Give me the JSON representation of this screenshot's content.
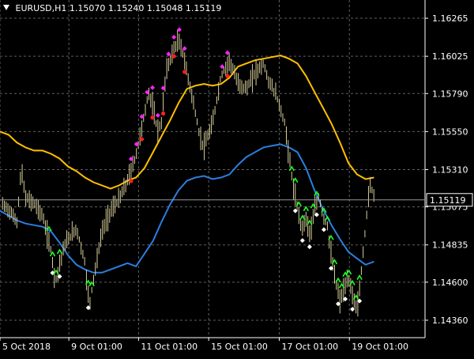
{
  "header": {
    "symbol": "EURUSD,H1",
    "open": "1.15070",
    "high": "1.15240",
    "low": "1.15048",
    "close": "1.15119"
  },
  "chart_data": {
    "type": "candlestick",
    "ylim": [
      1.1425,
      1.1638
    ],
    "xlim": [
      0,
      100
    ],
    "grid": true,
    "y_ticks": [
      "1.16265",
      "1.16025",
      "1.15790",
      "1.15550",
      "1.15310",
      "1.15075",
      "1.14835",
      "1.14600",
      "1.14360"
    ],
    "x_ticks": [
      {
        "label": "5 Oct 2018",
        "pos": 0
      },
      {
        "label": "9 Oct 01:00",
        "pos": 16.2
      },
      {
        "label": "11 Oct 01:00",
        "pos": 32.6
      },
      {
        "label": "15 Oct 01:00",
        "pos": 49.1
      },
      {
        "label": "17 Oct 01:00",
        "pos": 65.7
      },
      {
        "label": "19 Oct 01:00",
        "pos": 82.2
      }
    ],
    "current_price": {
      "label": "1.15119",
      "value": 1.15119
    },
    "price_waypoints": [
      [
        0,
        1.151
      ],
      [
        2,
        1.1506
      ],
      [
        4,
        1.1498
      ],
      [
        5,
        1.1532
      ],
      [
        6,
        1.1513
      ],
      [
        8,
        1.151
      ],
      [
        10,
        1.1502
      ],
      [
        12,
        1.148
      ],
      [
        13,
        1.146
      ],
      [
        15,
        1.1482
      ],
      [
        16,
        1.1487
      ],
      [
        18,
        1.1494
      ],
      [
        20,
        1.1472
      ],
      [
        21,
        1.1445
      ],
      [
        22,
        1.1462
      ],
      [
        24,
        1.1492
      ],
      [
        26,
        1.1505
      ],
      [
        28,
        1.1512
      ],
      [
        30,
        1.1524
      ],
      [
        32,
        1.154
      ],
      [
        34,
        1.1566
      ],
      [
        35,
        1.158
      ],
      [
        36,
        1.157
      ],
      [
        37,
        1.1556
      ],
      [
        38,
        1.156
      ],
      [
        39,
        1.1592
      ],
      [
        40,
        1.16
      ],
      [
        41,
        1.1608
      ],
      [
        42,
        1.1612
      ],
      [
        43,
        1.1605
      ],
      [
        44,
        1.1592
      ],
      [
        45,
        1.158
      ],
      [
        46,
        1.1566
      ],
      [
        47,
        1.1552
      ],
      [
        48,
        1.1545
      ],
      [
        50,
        1.156
      ],
      [
        52,
        1.159
      ],
      [
        54,
        1.16
      ],
      [
        56,
        1.1585
      ],
      [
        58,
        1.1582
      ],
      [
        60,
        1.1592
      ],
      [
        62,
        1.1598
      ],
      [
        63,
        1.1588
      ],
      [
        65,
        1.1578
      ],
      [
        67,
        1.156
      ],
      [
        68,
        1.154
      ],
      [
        69,
        1.152
      ],
      [
        70,
        1.1506
      ],
      [
        71,
        1.1494
      ],
      [
        72,
        1.15
      ],
      [
        73,
        1.149
      ],
      [
        74,
        1.1505
      ],
      [
        75,
        1.1514
      ],
      [
        76,
        1.1502
      ],
      [
        77,
        1.1496
      ],
      [
        78,
        1.1475
      ],
      [
        79,
        1.146
      ],
      [
        80,
        1.1448
      ],
      [
        81,
        1.1456
      ],
      [
        82,
        1.1462
      ],
      [
        83,
        1.1452
      ],
      [
        84,
        1.1442
      ],
      [
        85,
        1.1466
      ],
      [
        86,
        1.1495
      ],
      [
        87,
        1.1522
      ],
      [
        88,
        1.1515
      ]
    ],
    "series": [
      {
        "color": "#ffc000",
        "points": [
          [
            0,
            1.1555
          ],
          [
            2,
            1.1553
          ],
          [
            4,
            1.1548
          ],
          [
            6,
            1.1545
          ],
          [
            8,
            1.1543
          ],
          [
            10,
            1.1543
          ],
          [
            12,
            1.1541
          ],
          [
            14,
            1.1538
          ],
          [
            16,
            1.1533
          ],
          [
            18,
            1.153
          ],
          [
            20,
            1.1526
          ],
          [
            22,
            1.1523
          ],
          [
            24,
            1.1521
          ],
          [
            26,
            1.1519
          ],
          [
            28,
            1.1521
          ],
          [
            30,
            1.1524
          ],
          [
            32,
            1.1526
          ],
          [
            34,
            1.1532
          ],
          [
            36,
            1.1542
          ],
          [
            38,
            1.1552
          ],
          [
            40,
            1.1562
          ],
          [
            42,
            1.1573
          ],
          [
            44,
            1.1582
          ],
          [
            46,
            1.1584
          ],
          [
            48,
            1.1585
          ],
          [
            50,
            1.1584
          ],
          [
            52,
            1.1585
          ],
          [
            54,
            1.1589
          ],
          [
            56,
            1.1596
          ],
          [
            58,
            1.1598
          ],
          [
            60,
            1.16
          ],
          [
            62,
            1.1601
          ],
          [
            64,
            1.1602
          ],
          [
            66,
            1.1603
          ],
          [
            68,
            1.1601
          ],
          [
            70,
            1.1598
          ],
          [
            72,
            1.159
          ],
          [
            74,
            1.158
          ],
          [
            76,
            1.157
          ],
          [
            78,
            1.156
          ],
          [
            80,
            1.1548
          ],
          [
            82,
            1.1535
          ],
          [
            84,
            1.1528
          ],
          [
            86,
            1.1525
          ],
          [
            88,
            1.1526
          ]
        ]
      },
      {
        "color": "#2b7fe0",
        "points": [
          [
            0,
            1.1505
          ],
          [
            2,
            1.1502
          ],
          [
            4,
            1.1499
          ],
          [
            6,
            1.1497
          ],
          [
            8,
            1.1496
          ],
          [
            10,
            1.1495
          ],
          [
            12,
            1.1492
          ],
          [
            14,
            1.1485
          ],
          [
            16,
            1.1477
          ],
          [
            18,
            1.1471
          ],
          [
            20,
            1.1468
          ],
          [
            22,
            1.1466
          ],
          [
            24,
            1.1466
          ],
          [
            26,
            1.1468
          ],
          [
            28,
            1.147
          ],
          [
            30,
            1.1472
          ],
          [
            32,
            1.147
          ],
          [
            34,
            1.1478
          ],
          [
            36,
            1.1486
          ],
          [
            38,
            1.1498
          ],
          [
            40,
            1.1509
          ],
          [
            42,
            1.1518
          ],
          [
            44,
            1.1524
          ],
          [
            46,
            1.1526
          ],
          [
            48,
            1.1527
          ],
          [
            50,
            1.1525
          ],
          [
            52,
            1.1526
          ],
          [
            54,
            1.1528
          ],
          [
            56,
            1.1534
          ],
          [
            58,
            1.1539
          ],
          [
            60,
            1.1542
          ],
          [
            62,
            1.1545
          ],
          [
            64,
            1.1546
          ],
          [
            66,
            1.1547
          ],
          [
            68,
            1.1545
          ],
          [
            70,
            1.1542
          ],
          [
            72,
            1.1532
          ],
          [
            74,
            1.1518
          ],
          [
            76,
            1.1506
          ],
          [
            78,
            1.1496
          ],
          [
            80,
            1.1487
          ],
          [
            82,
            1.1479
          ],
          [
            84,
            1.1475
          ],
          [
            86,
            1.1471
          ],
          [
            88,
            1.1473
          ]
        ]
      }
    ],
    "marker_colors": {
      "buy_arrow": "#22ff22",
      "sell_dot": "#ff2020",
      "high_diamond": "#ff22ff",
      "low_diamond": "#ffffff"
    }
  }
}
